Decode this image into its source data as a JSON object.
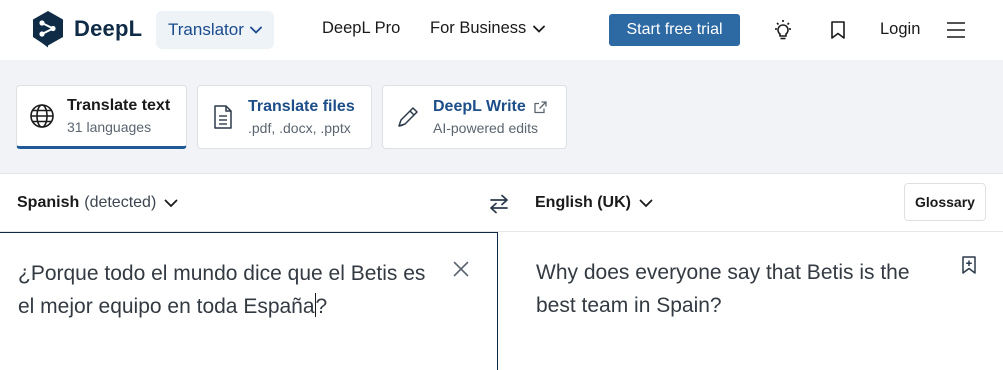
{
  "header": {
    "logo_text": "DeepL",
    "translator_label": "Translator",
    "links": [
      "DeepL Pro",
      "For Business"
    ],
    "trial_label": "Start free trial",
    "login_label": "Login",
    "icons": [
      "lightbulb-icon",
      "bookmark-icon",
      "menu-icon"
    ]
  },
  "modes": [
    {
      "title": "Translate text",
      "subtitle": "31 languages",
      "active": true,
      "icon": "globe-icon"
    },
    {
      "title": "Translate files",
      "subtitle": ".pdf, .docx, .pptx",
      "active": false,
      "icon": "file-icon"
    },
    {
      "title": "DeepL Write",
      "subtitle": "AI-powered edits",
      "active": false,
      "icon": "pen-icon"
    }
  ],
  "source": {
    "language": "Spanish",
    "detected_note": "(detected)",
    "text_before_caret": "¿Porque todo el mundo dice que el Betis es el mejor equipo en toda España",
    "text_after_caret": "?"
  },
  "target": {
    "language": "English (UK)",
    "text": "Why does everyone say that Betis is the best team in Spain?"
  },
  "glossary_label": "Glossary",
  "colors": {
    "brand_navy": "#0f2b46",
    "accent_blue": "#2d6aa4",
    "band_bg": "#f1f3f6"
  }
}
